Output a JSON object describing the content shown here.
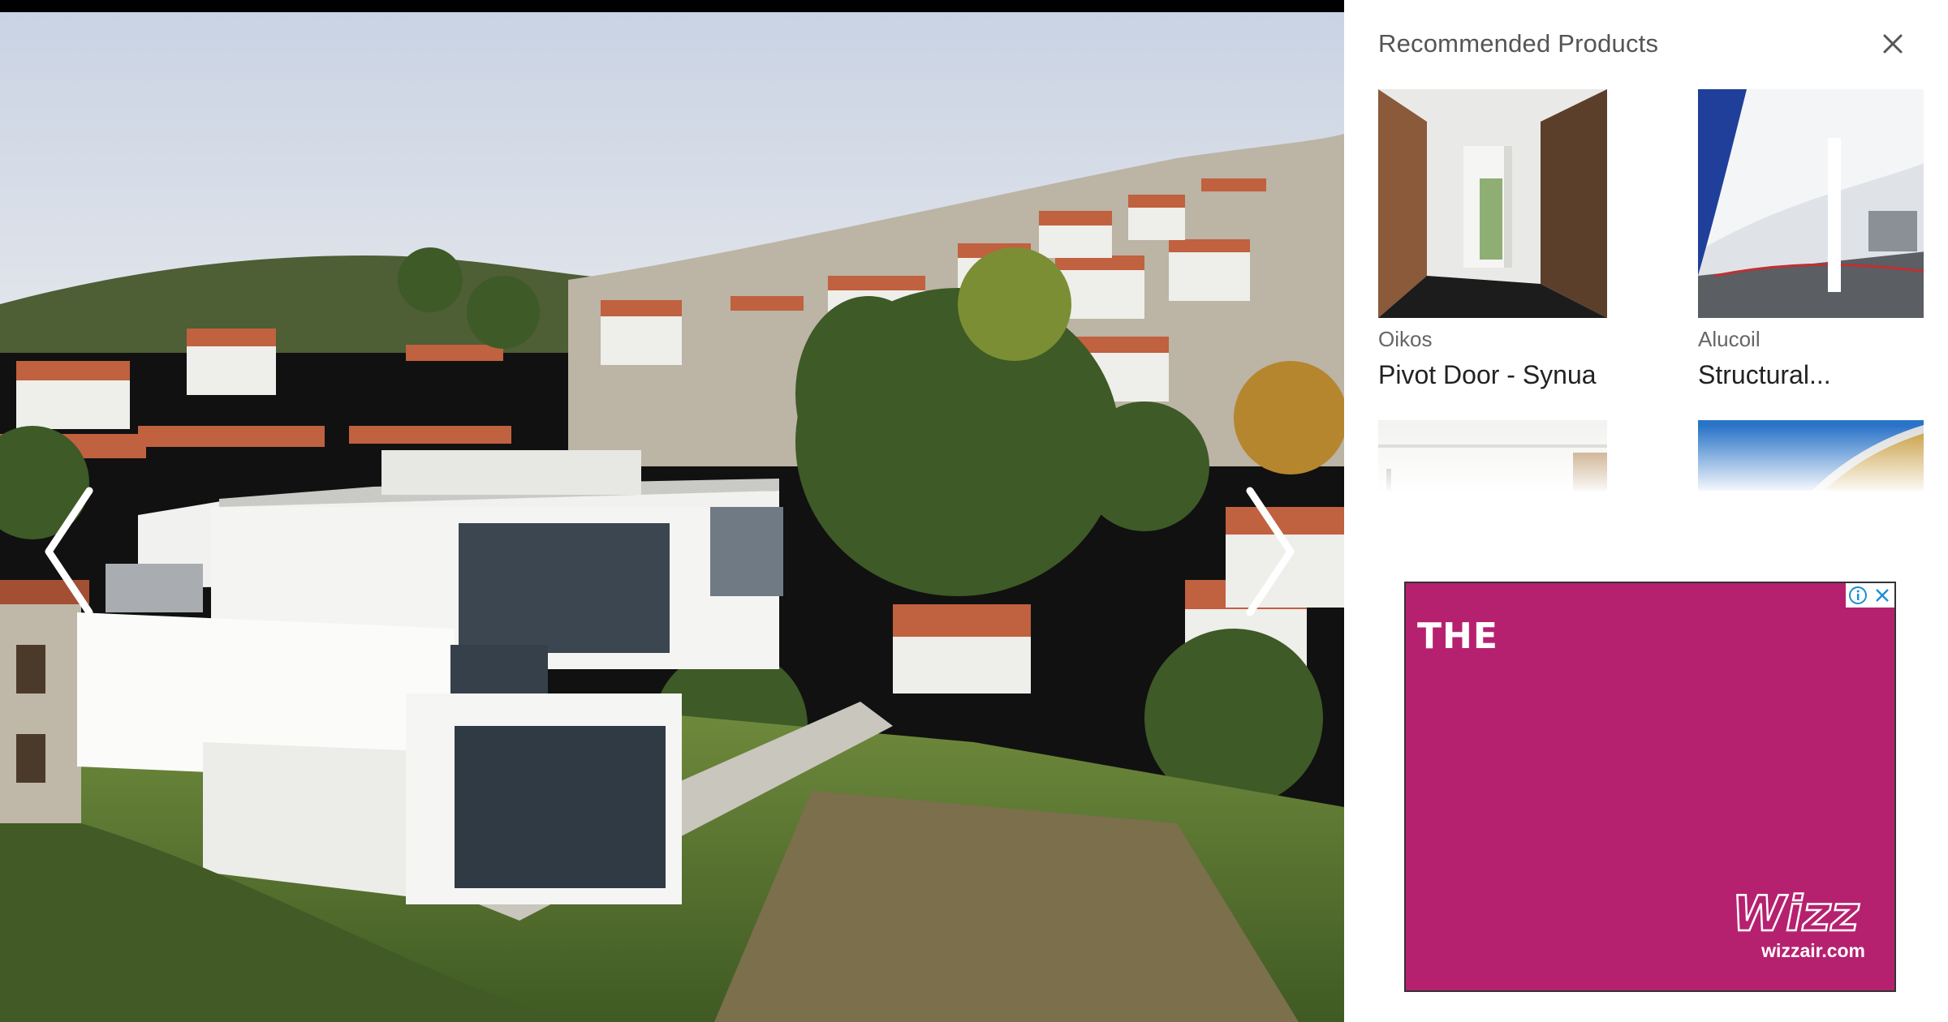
{
  "panel": {
    "title": "Recommended Products",
    "close_icon": "close-icon"
  },
  "gallery": {
    "prev_icon": "chevron-left-icon",
    "next_icon": "chevron-right-icon"
  },
  "products": [
    {
      "brand": "Oikos",
      "name": "Pivot Door - Synua"
    },
    {
      "brand": "Alucoil",
      "name": "Structural..."
    },
    {
      "brand": "",
      "name": ""
    },
    {
      "brand": "",
      "name": ""
    }
  ],
  "ad": {
    "headline": "THE",
    "logo_text": "Wizz",
    "url": "wizzair.com",
    "info_icon": "info-icon",
    "close_icon": "close-icon",
    "background": "#b6216f"
  },
  "colors": {
    "ad_magenta": "#b6216f",
    "panel_title": "#555555",
    "product_name": "#222222"
  }
}
